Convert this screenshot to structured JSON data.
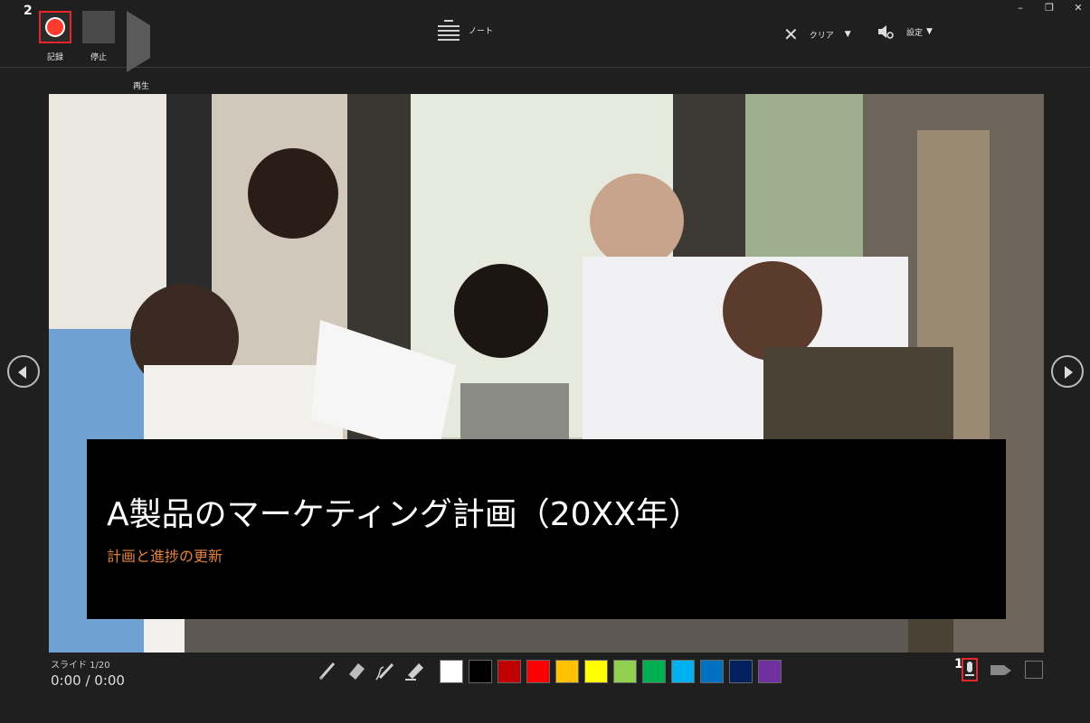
{
  "window": {
    "minimize": "–",
    "restore": "❐",
    "close": "✕"
  },
  "toolbar": {
    "record_label": "記録",
    "stop_label": "停止",
    "play_label": "再生",
    "notes_label": "ノート",
    "clear_label": "クリア",
    "settings_label": "設定"
  },
  "callouts": {
    "one": "1",
    "two": "2"
  },
  "slide": {
    "title": "A製品のマーケティング計画（20XX年）",
    "subtitle": "計画と進捗の更新"
  },
  "status": {
    "slide_number": "スライド 1/20",
    "time": "0:00 / 0:00"
  },
  "colors": {
    "accent_red": "#e8262b",
    "subtitle_orange": "#e3823a",
    "swatches": [
      "#ffffff",
      "#000000",
      "#c00000",
      "#ff0000",
      "#ffc000",
      "#ffff00",
      "#92d050",
      "#00b050",
      "#00b0f0",
      "#0070c0",
      "#002060",
      "#7030a0"
    ]
  },
  "icons": {
    "pen_tools": [
      "pen-icon",
      "eraser-icon",
      "highlighter-pen-icon",
      "marker-icon"
    ],
    "media": [
      "microphone-icon",
      "camera-off-icon",
      "camera-preview-icon"
    ]
  }
}
